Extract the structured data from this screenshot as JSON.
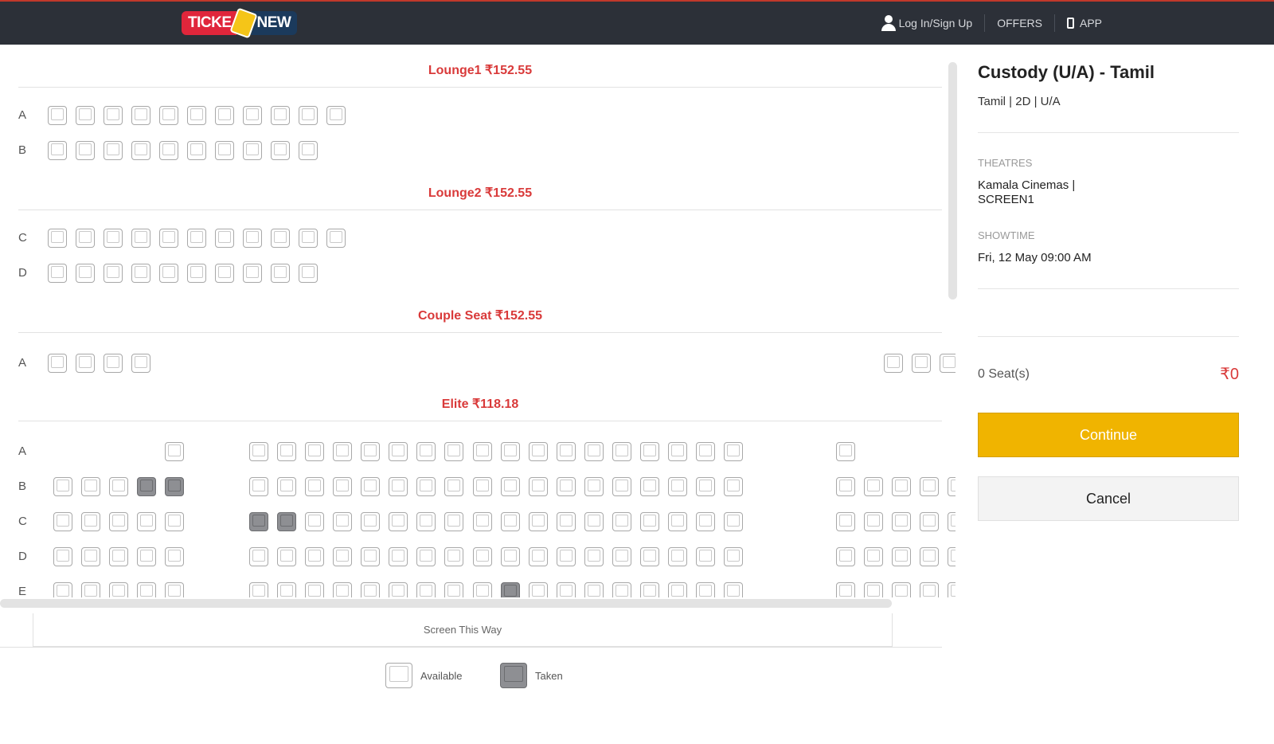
{
  "header": {
    "logo_left": "TICKE",
    "logo_right": "NEW",
    "login_label": "Log In/Sign Up",
    "offers_label": "OFFERS",
    "app_label": "APP"
  },
  "seat_map": {
    "sections": [
      {
        "title": "Lounge1 ₹152.55",
        "rows": [
          {
            "label": "A",
            "seats": "aaaaaaaaaaa"
          },
          {
            "label": "B",
            "seats": "aaaaaaaaaa"
          }
        ]
      },
      {
        "title": "Lounge2 ₹152.55",
        "rows": [
          {
            "label": "C",
            "seats": "aaaaaaaaaaa"
          },
          {
            "label": "D",
            "seats": "aaaaaaaaaa"
          }
        ]
      },
      {
        "title": "Couple Seat ₹152.55",
        "rows": [
          {
            "label": "A",
            "seats": "aaaa..........................aaaa"
          }
        ]
      },
      {
        "title": "Elite ₹118.18",
        "rows": [
          {
            "label": "A",
            "seats": "....a..aaaaaaaaaaaaaaaaaa...a...."
          },
          {
            "label": "B",
            "seats": "aaatt..aaaaaaaaaaaaaaaaaa...aaaaa"
          },
          {
            "label": "C",
            "seats": "aaaaa..ttaaaaaaaaaaaaaaaa...aaaaa"
          },
          {
            "label": "D",
            "seats": "aaaaa..aaaaaaaaaaaaaaaaaa...aaaaa"
          },
          {
            "label": "E",
            "seats": "aaaaa..aaaaaaaaataaaaaaaa...aaaaa"
          }
        ]
      }
    ],
    "screen_label": "Screen This Way",
    "legend": {
      "available": "Available",
      "taken": "Taken"
    }
  },
  "booking": {
    "movie_title": "Custody (U/A) - Tamil",
    "movie_meta": "Tamil | 2D | U/A",
    "theatres_label": "THEATRES",
    "theatre_line1": "Kamala Cinemas |",
    "theatre_line2": "SCREEN1",
    "showtime_label": "SHOWTIME",
    "showtime": "Fri, 12 May 09:00 AM",
    "seats_count": "0 Seat(s)",
    "amount": "₹0",
    "continue_label": "Continue",
    "cancel_label": "Cancel"
  },
  "colors": {
    "accent_red": "#d93a3a",
    "continue_yellow": "#f0b400",
    "header_bg": "#2c3038",
    "taken_seat": "#8e8f93"
  }
}
